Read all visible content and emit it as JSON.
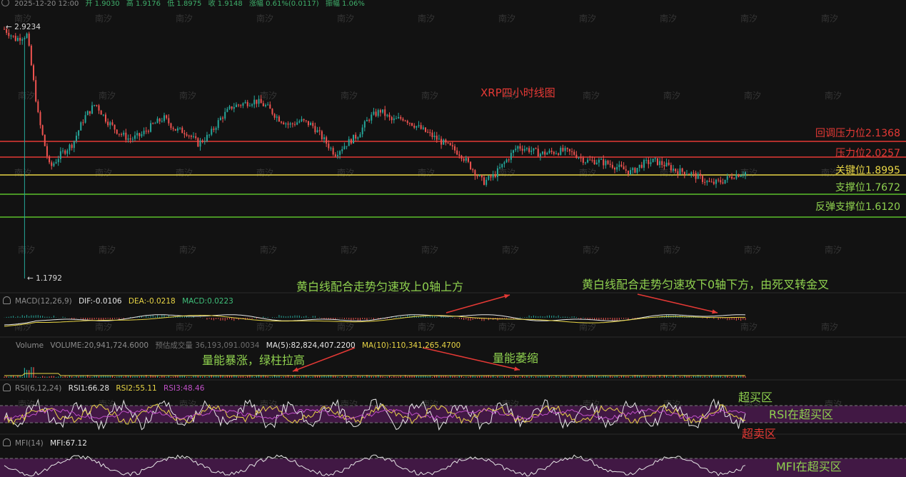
{
  "header": {
    "date": "2025-12-20 12:00",
    "open": "开 1.9030",
    "high": "高 1.9176",
    "low": "低 1.8975",
    "close": "收 1.9148",
    "change": "涨幅 0.61%(0.0117)",
    "amplitude": "振幅 1.06%"
  },
  "price_panel": {
    "title": "XRP四小时线图",
    "max_label": "← 2.9234",
    "min_label": "← 1.1792",
    "watermark": "南汐"
  },
  "levels": [
    {
      "label": "回调压力位2.1368",
      "value": 2.1368,
      "color": "#e53935"
    },
    {
      "label": "压力位2.0257",
      "value": 2.0257,
      "color": "#e53935"
    },
    {
      "label": "关键位1.8995",
      "value": 1.8995,
      "color": "#e8d545"
    },
    {
      "label": "支撑位1.7672",
      "value": 1.7672,
      "color": "#5bbf2a"
    },
    {
      "label": "反弹支撑位1.6120",
      "value": 1.612,
      "color": "#5bbf2a"
    }
  ],
  "macd": {
    "name": "MACD(12,26,9)",
    "dif": "DIF:-0.0106",
    "dea": "DEA:-0.0218",
    "macd": "MACD:0.0223",
    "note_up": "黄白线配合走势匀速攻上0轴上方",
    "note_down": "黄白线配合走势匀速攻下0轴下方，由死叉转金叉"
  },
  "volume": {
    "name": "Volume",
    "volume": "VOLUME:20,941,724.6000",
    "predicted": "预估成交量 36,193,091.0034",
    "ma5": "MA(5):82,824,407.2200",
    "ma10": "MA(10):110,341,265.4700",
    "note_surge": "量能暴涨，绿柱拉高",
    "note_shrink": "量能萎缩"
  },
  "rsi": {
    "name": "RSI(6,12,24)",
    "rsi1": "RSI1:66.28",
    "rsi2": "RSI2:55.11",
    "rsi3": "RSI3:48.46",
    "overbought": "超买区",
    "status": "RSI在超买区",
    "oversold": "超卖区"
  },
  "mfi": {
    "name": "MFI(14)",
    "mfi": "MFI:67.12",
    "status": "MFI在超买区"
  },
  "colors": {
    "up": "#26a69a",
    "down": "#ef5350",
    "dif_line": "#e6e6e6",
    "dea_line": "#e8d545",
    "band": "#4a1a4e",
    "annotation_green": "#8fd14f",
    "annotation_red": "#e53935",
    "arrow_red": "#e53935"
  },
  "chart_data": {
    "type": "candlestick",
    "title": "XRP四小时线图",
    "y_price_range": [
      1.1792,
      2.9234
    ],
    "price_path": [
      2.92,
      2.85,
      2.88,
      2.3,
      1.95,
      2.05,
      2.12,
      2.3,
      2.4,
      2.28,
      2.2,
      2.15,
      2.18,
      2.25,
      2.3,
      2.22,
      2.2,
      2.12,
      2.18,
      2.3,
      2.38,
      2.4,
      2.42,
      2.38,
      2.3,
      2.25,
      2.28,
      2.25,
      2.15,
      2.05,
      2.12,
      2.18,
      2.3,
      2.35,
      2.28,
      2.3,
      2.25,
      2.2,
      2.15,
      2.1,
      2.05,
      1.95,
      1.85,
      1.9,
      2.0,
      2.1,
      2.08,
      2.05,
      2.06,
      2.07,
      2.05,
      2.0,
      2.0,
      1.98,
      1.95,
      1.92,
      1.98,
      2.0,
      1.97,
      1.93,
      1.92,
      1.88,
      1.84,
      1.86,
      1.9,
      1.92
    ],
    "levels": [
      2.1368,
      2.0257,
      1.8995,
      1.7672,
      1.612
    ]
  }
}
